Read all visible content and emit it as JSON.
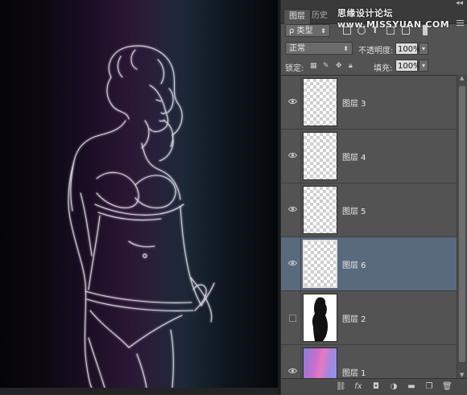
{
  "panel": {
    "tabs": [
      {
        "label": "图层",
        "active": true
      },
      {
        "label": "历史",
        "active": false
      }
    ],
    "watermark": "思缘设计论坛 www.MISSYUAN.COM",
    "filter": {
      "label": "ρ 类型",
      "icons": [
        "image-filter-icon",
        "adjustment-filter-icon",
        "type-filter-icon",
        "shape-filter-icon",
        "smart-object-filter-icon",
        "filter-toggle-icon"
      ]
    },
    "blend_mode": "正常",
    "opacity_label": "不透明度:",
    "opacity_value": "100%",
    "lock_label": "锁定:",
    "fill_label": "填充:",
    "fill_value": "100%"
  },
  "layers": [
    {
      "name": "图层 3",
      "visible": true,
      "selected": false,
      "thumb": "transparent"
    },
    {
      "name": "图层 4",
      "visible": true,
      "selected": false,
      "thumb": "transparent"
    },
    {
      "name": "图层 5",
      "visible": true,
      "selected": false,
      "thumb": "transparent"
    },
    {
      "name": "图层 6",
      "visible": true,
      "selected": true,
      "thumb": "transparent"
    },
    {
      "name": "图层 2",
      "visible": false,
      "selected": false,
      "thumb": "silhouette"
    },
    {
      "name": "图层 1",
      "visible": true,
      "selected": false,
      "thumb": "gradient"
    }
  ],
  "colors": {
    "panel_bg": "#535353",
    "selected_layer": "#5a6a7d",
    "canvas_gradient": [
      "#050508",
      "#2a1634",
      "#1d2838",
      "#05080b"
    ]
  },
  "bottom_icons": [
    "link-layers-icon",
    "fx-icon",
    "layer-mask-icon",
    "adjustment-layer-icon",
    "new-group-icon",
    "new-layer-icon",
    "delete-layer-icon"
  ]
}
